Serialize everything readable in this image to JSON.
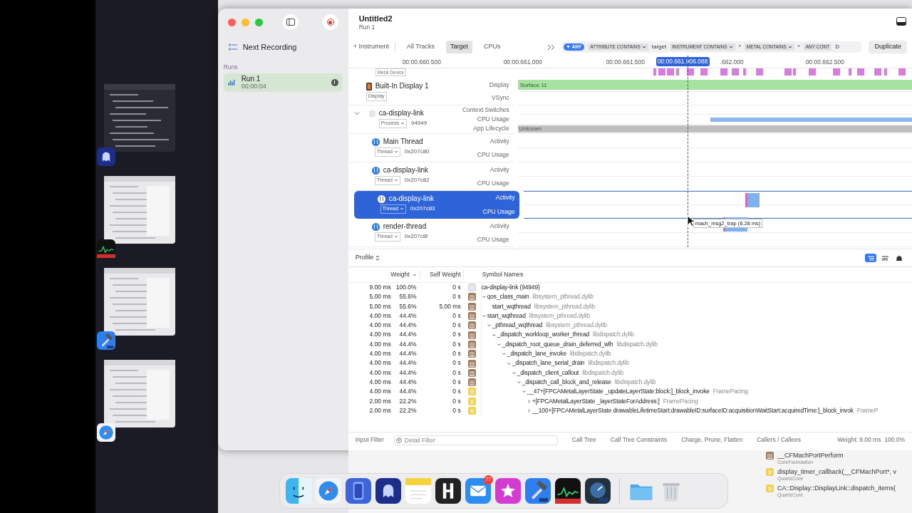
{
  "window": {
    "title": "Untitled2",
    "subtitle": "Run 1"
  },
  "sidebar": {
    "next_recording": "Next Recording",
    "runs_heading": "Runs",
    "runs": [
      {
        "name": "Run 1",
        "duration": "00:00:04",
        "selected": true
      }
    ]
  },
  "toolbar": {
    "add_instrument": "+ Instrument",
    "scopes": [
      {
        "label": "All Tracks",
        "selected": false
      },
      {
        "label": "Target",
        "selected": true
      },
      {
        "label": "CPUs",
        "selected": false
      }
    ],
    "filters": [
      {
        "kind": "any",
        "label": "ANY"
      },
      {
        "kind": "token",
        "label": "ATTRIBUTE CONTAINS",
        "value": "target"
      },
      {
        "kind": "token",
        "label": "INSTRUMENT CONTAINS",
        "value": "*"
      },
      {
        "kind": "token",
        "label": "METAL CONTAINS",
        "value": "*"
      },
      {
        "kind": "cut",
        "label": "ANY CONT",
        "value": "D"
      }
    ],
    "duplicate": "Duplicate"
  },
  "ruler": {
    "ticks": [
      "00:00.660.500",
      "00:00.661.000",
      "00:00.661.500",
      ".662.000",
      "00:00.662.500"
    ],
    "cursor": "00:00.661.906.088"
  },
  "partial_track_badge": "Metal Device",
  "tracks": [
    {
      "kind": "display",
      "name": "Built-In Display 1",
      "badge": "Display",
      "selected": false,
      "lanes": [
        {
          "label": "Display",
          "kind": "surface",
          "bar_label": "Surface 11"
        },
        {
          "label": "VSync"
        }
      ]
    },
    {
      "kind": "process",
      "name": "ca-display-link",
      "badge": "Process",
      "id": "94949",
      "selected": false,
      "expanded": true,
      "lanes": [
        {
          "label": "Context Switches"
        },
        {
          "label": "CPU Usage",
          "kind": "cpu"
        },
        {
          "label": "App Lifecycle",
          "kind": "lifecycle",
          "bar_label": "Unknown"
        }
      ]
    },
    {
      "kind": "thread",
      "name": "Main Thread",
      "badge": "Thread",
      "id": "0x207c80",
      "selected": false,
      "lanes": [
        {
          "label": "Activity"
        },
        {
          "label": "CPU Usage"
        }
      ]
    },
    {
      "kind": "thread",
      "name": "ca-display-link",
      "badge": "Thread",
      "id": "0x207c82",
      "selected": false,
      "lanes": [
        {
          "label": "Activity"
        },
        {
          "label": "CPU Usage"
        }
      ]
    },
    {
      "kind": "thread",
      "name": "ca-display-link",
      "badge": "Thread",
      "id": "0x207c83",
      "selected": true,
      "lanes": [
        {
          "label": "Activity",
          "kind": "block"
        },
        {
          "label": "CPU Usage"
        }
      ]
    },
    {
      "kind": "thread",
      "name": "render-thread",
      "badge": "Thread",
      "id": "0x207c8f",
      "selected": false,
      "lanes": [
        {
          "label": "Activity",
          "kind": "wide_block"
        },
        {
          "label": "CPU Usage"
        }
      ]
    }
  ],
  "tooltip": "mach_msg2_trap (8.28 ms)",
  "profile": {
    "mode": "Profile",
    "views": [
      {
        "kind": "list",
        "selected": true
      },
      {
        "kind": "flame",
        "selected": false
      },
      {
        "kind": "weight",
        "selected": false
      }
    ],
    "columns": [
      "Weight",
      "Self Weight",
      "Symbol Names"
    ],
    "rows": [
      {
        "weight": "9.00 ms",
        "percent": "100.0%",
        "self": "0 s",
        "kind": "process",
        "symbol": "ca-display-link (94949)",
        "children": [
          {
            "weight": "5.00 ms",
            "percent": "55.6%",
            "self": "0 s",
            "kind": "system",
            "symbol": "qos_class_main",
            "library": "libsystem_pthread.dylib",
            "expanded": true,
            "children": [
              {
                "weight": "5.00 ms",
                "percent": "55.6%",
                "self": "5.00 ms",
                "kind": "system",
                "symbol": "start_wqthread",
                "library": "libsystem_pthread.dylib"
              }
            ]
          },
          {
            "weight": "4.00 ms",
            "percent": "44.4%",
            "self": "0 s",
            "kind": "system",
            "symbol": "start_wqthread",
            "library": "libsystem_pthread.dylib",
            "expanded": true,
            "children": [
              {
                "weight": "4.00 ms",
                "percent": "44.4%",
                "self": "0 s",
                "kind": "system",
                "symbol": "_pthread_wqthread",
                "library": "libsystem_pthread.dylib",
                "expanded": true,
                "children": [
                  {
                    "weight": "4.00 ms",
                    "percent": "44.4%",
                    "self": "0 s",
                    "kind": "system",
                    "symbol": "_dispatch_workloop_worker_thread",
                    "library": "libdispatch.dylib",
                    "expanded": true,
                    "children": [
                      {
                        "weight": "4.00 ms",
                        "percent": "44.4%",
                        "self": "0 s",
                        "kind": "system",
                        "symbol": "_dispatch_root_queue_drain_deferred_wlh",
                        "library": "libdispatch.dylib",
                        "expanded": true,
                        "children": [
                          {
                            "weight": "4.00 ms",
                            "percent": "44.4%",
                            "self": "0 s",
                            "kind": "system",
                            "symbol": "_dispatch_lane_invoke",
                            "library": "libdispatch.dylib",
                            "expanded": true,
                            "children": [
                              {
                                "weight": "4.00 ms",
                                "percent": "44.4%",
                                "self": "0 s",
                                "kind": "system",
                                "symbol": "_dispatch_lane_serial_drain",
                                "library": "libdispatch.dylib",
                                "expanded": true,
                                "children": [
                                  {
                                    "weight": "4.00 ms",
                                    "percent": "44.4%",
                                    "self": "0 s",
                                    "kind": "system",
                                    "symbol": "_dispatch_client_callout",
                                    "library": "libdispatch.dylib",
                                    "expanded": true,
                                    "children": [
                                      {
                                        "weight": "4.00 ms",
                                        "percent": "44.4%",
                                        "self": "0 s",
                                        "kind": "system",
                                        "symbol": "_dispatch_call_block_and_release",
                                        "library": "libdispatch.dylib",
                                        "expanded": true,
                                        "children": [
                                          {
                                            "weight": "4.00 ms",
                                            "percent": "44.4%",
                                            "self": "0 s",
                                            "kind": "user",
                                            "symbol": "__47+[FPCAMetalLayerState _updateLayerState:block:]_block_invoke",
                                            "library": "FramePacing",
                                            "expanded": true,
                                            "children": [
                                              {
                                                "weight": "2.00 ms",
                                                "percent": "22.2%",
                                                "self": "0 s",
                                                "kind": "user",
                                                "symbol": "+[FPCAMetalLayerState _layerStateForAddress:]",
                                                "library": "FramePacing",
                                                "expanded": false
                                              },
                                              {
                                                "weight": "2.00 ms",
                                                "percent": "22.2%",
                                                "self": "0 s",
                                                "kind": "user",
                                                "symbol": "__100+[FPCAMetalLayerState drawableLifetimeStart:drawableID:surfaceID:acquisitionWaitStart:acquiredTime:]_block_invok",
                                                "library": "FrameP",
                                                "expanded": false
                                              }
                                            ]
                                          }
                                        ]
                                      }
                                    ]
                                  }
                                ]
                              }
                            ]
                          }
                        ]
                      }
                    ]
                  }
                ]
              }
            ]
          }
        ]
      }
    ]
  },
  "bottom_bar": {
    "input_filter": "Input Filter",
    "detail_filter": {
      "placeholder": "Detail Filter"
    },
    "buttons": [
      "Call Tree",
      "Call Tree Constraints",
      "Charge, Prune, Flatten",
      "Callers / Callees"
    ],
    "summary": "Weight: 9.00 ms  100.0%"
  },
  "background_list": [
    {
      "kind": "system",
      "symbol": "__CFMachPortPerform",
      "library": "CoreFoundation"
    },
    {
      "kind": "user",
      "symbol": "display_timer_callback(__CFMachPort*, v",
      "library": "QuartzCore"
    },
    {
      "kind": "user",
      "symbol": "CA::Display::DisplayLink::dispatch_items(",
      "library": "QuartzCore"
    }
  ],
  "dock": [
    {
      "kind": "finder"
    },
    {
      "kind": "safari"
    },
    {
      "kind": "simulator"
    },
    {
      "kind": "ghost"
    },
    {
      "kind": "notes"
    },
    {
      "kind": "hbold"
    },
    {
      "kind": "mail",
      "badge": "77"
    },
    {
      "kind": "star"
    },
    {
      "kind": "xcode"
    },
    {
      "kind": "activity"
    },
    {
      "kind": "instruments"
    },
    {
      "kind": "separator"
    },
    {
      "kind": "folder"
    },
    {
      "kind": "trash"
    }
  ],
  "stage": [
    {
      "kind": "dark",
      "app": {
        "kind": "ghost"
      }
    },
    {
      "kind": "light",
      "app": {
        "kind": "activity"
      }
    },
    {
      "kind": "light",
      "app": {
        "kind": "xcode"
      }
    },
    {
      "kind": "light",
      "app": {
        "kind": "safari"
      }
    }
  ]
}
